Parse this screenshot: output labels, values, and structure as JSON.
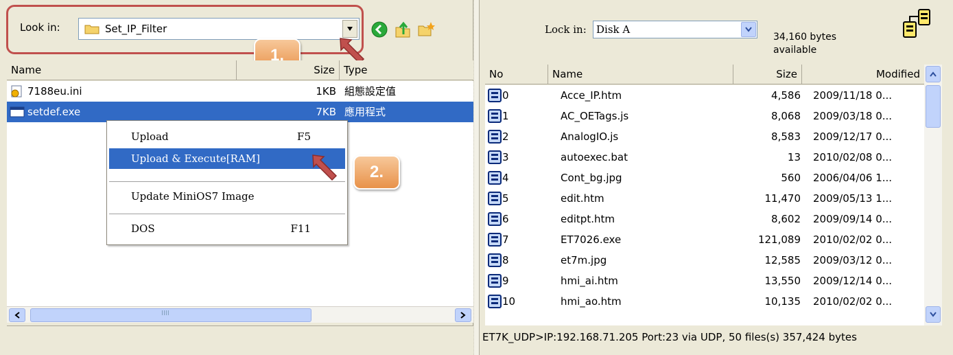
{
  "left": {
    "lookin_label": "Look in:",
    "lookin_value": "Set_IP_Filter",
    "step1": "1.",
    "step2": "2.",
    "columns": {
      "name": "Name",
      "size": "Size",
      "type": "Type"
    },
    "files": [
      {
        "name": "7188eu.ini",
        "size": "1KB",
        "type": "組態設定值",
        "icon": "ini-file-icon"
      },
      {
        "name": "setdef.exe",
        "size": "7KB",
        "type": "應用程式",
        "icon": "exe-file-icon"
      }
    ],
    "scroll_grip": "IIII"
  },
  "context_menu": {
    "items": [
      {
        "label": "Upload",
        "key": "F5"
      },
      {
        "label": "Upload & Execute[RAM]",
        "key": ""
      },
      {
        "label": "Update MiniOS7 Image",
        "key": ""
      },
      {
        "label": "DOS",
        "key": "F11"
      }
    ]
  },
  "right": {
    "lookin_label": "Lock in:",
    "lookin_value": "Disk A",
    "free_bytes": "34,160 bytes",
    "free_label": "available",
    "columns": {
      "no": "No",
      "name": "Name",
      "size": "Size",
      "modified": "Modified"
    },
    "files": [
      {
        "no": "0",
        "name": "Acce_IP.htm",
        "size": "4,586",
        "modified": "2009/11/18  0..."
      },
      {
        "no": "1",
        "name": "AC_OETags.js",
        "size": "8,068",
        "modified": "2009/03/18  0..."
      },
      {
        "no": "2",
        "name": "AnalogIO.js",
        "size": "8,583",
        "modified": "2009/12/17  0..."
      },
      {
        "no": "3",
        "name": "autoexec.bat",
        "size": "13",
        "modified": "2010/02/08  0..."
      },
      {
        "no": "4",
        "name": "Cont_bg.jpg",
        "size": "560",
        "modified": "2006/04/06  1..."
      },
      {
        "no": "5",
        "name": "edit.htm",
        "size": "11,470",
        "modified": "2009/05/13  1..."
      },
      {
        "no": "6",
        "name": "editpt.htm",
        "size": "8,602",
        "modified": "2009/09/14  0..."
      },
      {
        "no": "7",
        "name": "ET7026.exe",
        "size": "121,089",
        "modified": "2010/02/02  0..."
      },
      {
        "no": "8",
        "name": "et7m.jpg",
        "size": "12,585",
        "modified": "2009/03/12  0..."
      },
      {
        "no": "9",
        "name": "hmi_ai.htm",
        "size": "13,550",
        "modified": "2009/12/14  0..."
      },
      {
        "no": "10",
        "name": "hmi_ao.htm",
        "size": "10,135",
        "modified": "2010/02/02  0..."
      }
    ],
    "status": "ET7K_UDP>IP:192.168.71.205 Port:23 via UDP, 50 files(s) 357,424 bytes"
  },
  "colors": {
    "selection": "#316ac5",
    "callout": "#c0504d",
    "badge": "#e8924a",
    "face": "#ece9d8"
  }
}
